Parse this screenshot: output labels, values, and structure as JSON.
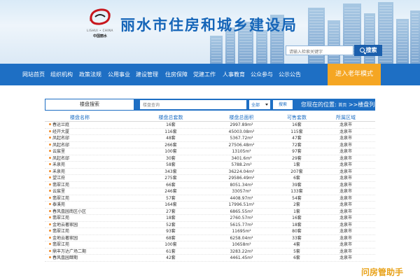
{
  "header": {
    "logo_sub": "LISHUI • CHINA",
    "logo_sub2": "中国丽水",
    "title": "丽水市住房和城乡建设局",
    "search_placeholder": "请输入检索关键字",
    "search_button": "搜索"
  },
  "nav": {
    "items": [
      "网站首页",
      "组织机构",
      "政策法规",
      "公用事业",
      "建设管理",
      "住房保障",
      "党建工作",
      "人事教育",
      "公众参与",
      "公示公告"
    ],
    "elder_mode": "进入老年模式",
    "colors": {
      "nav_bg": "#1e6fc4",
      "elder_bg": "#f5a623"
    }
  },
  "search_bar": {
    "label": "楼盘搜索",
    "input_placeholder": "楼盘查询",
    "select_value": "全部",
    "button": "搜索",
    "location_prefix": "您现在的位置:",
    "location_home": "首页",
    "location_rest": ">>楼盘列表>>楼盘搜索"
  },
  "table": {
    "headers": [
      "楼盘名称",
      "楼盘总套数",
      "楼盘总面积",
      "可售套数",
      "所属区域"
    ],
    "rows": [
      [
        "春运兰庭",
        "16套",
        "2997.89m²",
        "16套",
        "龙泉市"
      ],
      [
        "经开大厦",
        "116套",
        "45003.08m²",
        "115套",
        "龙泉市"
      ],
      [
        "凤起名邸",
        "48套",
        "5367.72m²",
        "47套",
        "龙泉市"
      ],
      [
        "凤起名邸",
        "266套",
        "27506.48m²",
        "72套",
        "龙泉市"
      ],
      [
        "云宸里",
        "100套",
        "13105m²",
        "97套",
        "龙泉市"
      ],
      [
        "凤起名邸",
        "30套",
        "3401.6m²",
        "29套",
        "龙泉市"
      ],
      [
        "禾泉苑",
        "58套",
        "5788.2m²",
        "1套",
        "龙泉市"
      ],
      [
        "禾泉苑",
        "343套",
        "36224.04m²",
        "207套",
        "龙泉市"
      ],
      [
        "望江府",
        "275套",
        "29586.49m²",
        "6套",
        "龙泉市"
      ],
      [
        "翡翠江苑",
        "66套",
        "8051.34m²",
        "39套",
        "龙泉市"
      ],
      [
        "云宸里",
        "246套",
        "33057m²",
        "133套",
        "龙泉市"
      ],
      [
        "翡翠江苑",
        "57套",
        "4408.97m²",
        "54套",
        "龙泉市"
      ],
      [
        "泰溪苑",
        "164套",
        "17996.51m²",
        "2套",
        "龙泉市"
      ],
      [
        "春风凰园南区小区",
        "27套",
        "6865.55m²",
        "1套",
        "龙泉市"
      ],
      [
        "翡翠江苑",
        "18套",
        "2760.57m²",
        "16套",
        "龙泉市"
      ],
      [
        "金地云著家园",
        "52套",
        "5615.77m²",
        "18套",
        "龙泉市"
      ],
      [
        "翡翠江苑",
        "93套",
        "11695m²",
        "80套",
        "龙泉市"
      ],
      [
        "金地云著家园",
        "68套",
        "6258.04m²",
        "33套",
        "龙泉市"
      ],
      [
        "翡翠江苑",
        "100套",
        "10658m²",
        "4套",
        "龙泉市"
      ],
      [
        "鼎丰万达广场二期",
        "61套",
        "3283.22m²",
        "5套",
        "龙泉市"
      ],
      [
        "春风凰园肆期",
        "42套",
        "4461.45m²",
        "6套",
        "龙泉市"
      ]
    ]
  },
  "watermark": "问房管助手"
}
